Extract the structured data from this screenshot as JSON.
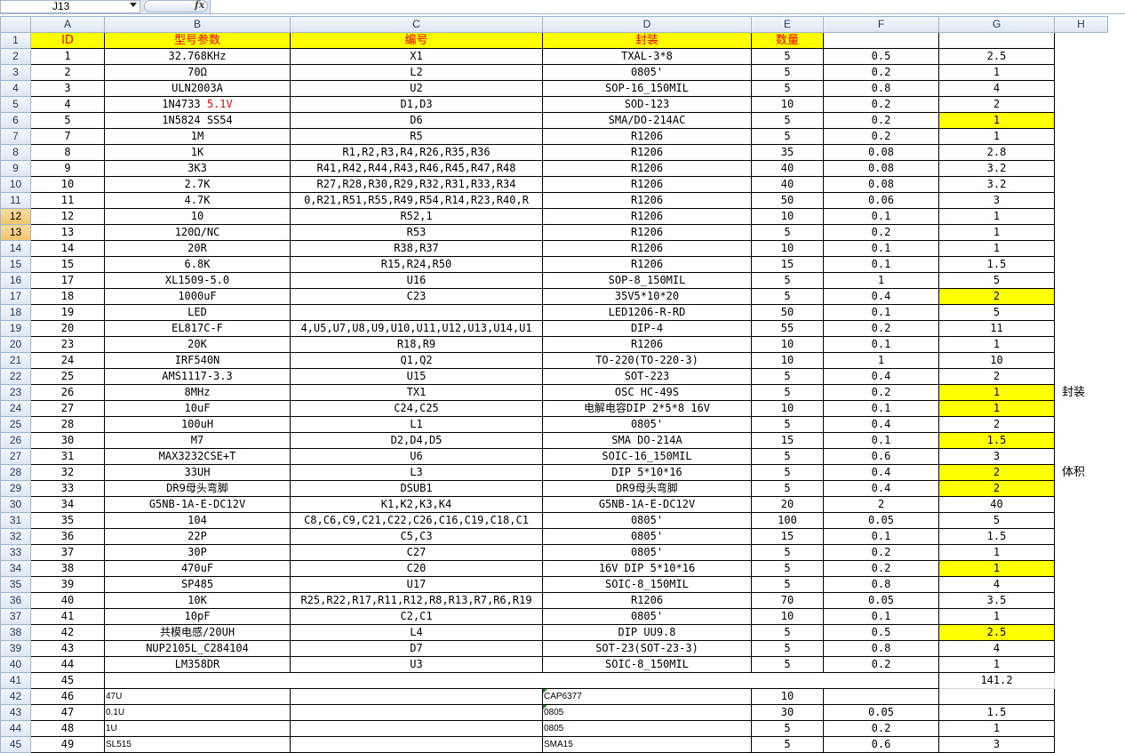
{
  "name_box": "J13",
  "fx_label": "fx",
  "columns": [
    "A",
    "B",
    "C",
    "D",
    "E",
    "F",
    "G",
    "H"
  ],
  "header": {
    "row": "1",
    "a": "ID",
    "b": "型号参数",
    "c": "编号",
    "d": "封装",
    "e": "数量"
  },
  "rows": [
    {
      "r": "2",
      "a": "1",
      "b": "32.768KHz",
      "c": "X1",
      "d": "TXAL-3*8",
      "e": "5",
      "f": "0.5",
      "g": "2.5",
      "h": ""
    },
    {
      "r": "3",
      "a": "2",
      "b": "70Ω",
      "c": "L2",
      "d": "0805'",
      "e": "5",
      "f": "0.2",
      "g": "1",
      "h": ""
    },
    {
      "r": "4",
      "a": "3",
      "b": "ULN2003A",
      "c": "U2",
      "d": "SOP-16_150MIL",
      "e": "5",
      "f": "0.8",
      "g": "4",
      "h": ""
    },
    {
      "r": "5",
      "a": "4",
      "b": "1N4733 ",
      "b2": "5.1V",
      "c": "D1,D3",
      "d": "SOD-123",
      "e": "10",
      "f": "0.2",
      "g": "2",
      "h": ""
    },
    {
      "r": "6",
      "a": "5",
      "b": "1N5824 SS54",
      "c": "D6",
      "d": "SMA/DO-214AC",
      "e": "5",
      "f": "0.2",
      "g": "1",
      "h": ""
    },
    {
      "r": "7",
      "a": "7",
      "b": "1M",
      "c": "R5",
      "d": "R1206",
      "e": "5",
      "f": "0.2",
      "g": "1",
      "h": ""
    },
    {
      "r": "8",
      "a": "8",
      "b": "1K",
      "c": "R1,R2,R3,R4,R26,R35,R36",
      "d": "R1206",
      "e": "35",
      "f": "0.08",
      "g": "2.8",
      "h": ""
    },
    {
      "r": "9",
      "a": "9",
      "b": "3K3",
      "c": "R41,R42,R44,R43,R46,R45,R47,R48",
      "d": "R1206",
      "e": "40",
      "f": "0.08",
      "g": "3.2",
      "h": ""
    },
    {
      "r": "10",
      "a": "10",
      "b": "2.7K",
      "c": "R27,R28,R30,R29,R32,R31,R33,R34",
      "d": "R1206",
      "e": "40",
      "f": "0.08",
      "g": "3.2",
      "h": ""
    },
    {
      "r": "11",
      "a": "11",
      "b": "4.7K",
      "c": "0,R21,R51,R55,R49,R54,R14,R23,R40,R",
      "d": "R1206",
      "e": "50",
      "f": "0.06",
      "g": "3",
      "h": ""
    },
    {
      "r": "12",
      "a": "12",
      "b": "10",
      "c": "R52,1",
      "d": "R1206",
      "e": "10",
      "f": "0.1",
      "g": "1",
      "h": ""
    },
    {
      "r": "13",
      "a": "13",
      "b": "120Ω/NC",
      "c": "R53",
      "d": "R1206",
      "e": "5",
      "f": "0.2",
      "g": "1",
      "h": ""
    },
    {
      "r": "14",
      "a": "14",
      "b": "20R",
      "c": "R38,R37",
      "d": "R1206",
      "e": "10",
      "f": "0.1",
      "g": "1",
      "h": ""
    },
    {
      "r": "15",
      "a": "15",
      "b": "6.8K",
      "c": "R15,R24,R50",
      "d": "R1206",
      "e": "15",
      "f": "0.1",
      "g": "1.5",
      "h": ""
    },
    {
      "r": "16",
      "a": "17",
      "b": "XL1509-5.0",
      "c": "U16",
      "d": "SOP-8_150MIL",
      "e": "5",
      "f": "1",
      "g": "5",
      "h": ""
    },
    {
      "r": "17",
      "a": "18",
      "b": "1000uF",
      "c": "C23",
      "d": "35V5*10*20",
      "e": "5",
      "f": "0.4",
      "g": "2",
      "h": ""
    },
    {
      "r": "18",
      "a": "19",
      "b": "LED",
      "c": "",
      "d": "LED1206-R-RD",
      "e": "50",
      "f": "0.1",
      "g": "5",
      "h": ""
    },
    {
      "r": "19",
      "a": "20",
      "b": "EL817C-F",
      "c": "4,U5,U7,U8,U9,U10,U11,U12,U13,U14,U1",
      "d": "DIP-4",
      "e": "55",
      "f": "0.2",
      "g": "11",
      "h": ""
    },
    {
      "r": "20",
      "a": "23",
      "b": "20K",
      "c": "R18,R9",
      "d": "R1206",
      "e": "10",
      "f": "0.1",
      "g": "1",
      "h": ""
    },
    {
      "r": "21",
      "a": "24",
      "b": "IRF540N",
      "c": "Q1,Q2",
      "d": "TO-220(TO-220-3)",
      "e": "10",
      "f": "1",
      "g": "10",
      "h": ""
    },
    {
      "r": "22",
      "a": "25",
      "b": "AMS1117-3.3",
      "c": "U15",
      "d": "SOT-223",
      "e": "5",
      "f": "0.4",
      "g": "2",
      "h": ""
    },
    {
      "r": "23",
      "a": "26",
      "b": "8MHz",
      "c": "TX1",
      "d": "OSC HC-49S",
      "e": "5",
      "f": "0.2",
      "g": "1",
      "h": "封装"
    },
    {
      "r": "24",
      "a": "27",
      "b": "10uF",
      "c": "C24,C25",
      "d": "电解电容DIP 2*5*8 16V",
      "e": "10",
      "f": "0.1",
      "g": "1",
      "h": ""
    },
    {
      "r": "25",
      "a": "28",
      "b": "100uH",
      "c": "L1",
      "d": "0805'",
      "e": "5",
      "f": "0.4",
      "g": "2",
      "h": ""
    },
    {
      "r": "26",
      "a": "30",
      "b": "M7",
      "c": "D2,D4,D5",
      "d": "SMA  DO-214A",
      "e": "15",
      "f": "0.1",
      "g": "1.5",
      "h": ""
    },
    {
      "r": "27",
      "a": "31",
      "b": "MAX3232CSE+T",
      "c": "U6",
      "d": "SOIC-16_150MIL",
      "e": "5",
      "f": "0.6",
      "g": "3",
      "h": ""
    },
    {
      "r": "28",
      "a": "32",
      "b": "33UH",
      "c": "L3",
      "d": "DIP 5*10*16",
      "e": "5",
      "f": "0.4",
      "g": "2",
      "h": "体积"
    },
    {
      "r": "29",
      "a": "33",
      "b": "DR9母头弯脚",
      "c": "DSUB1",
      "d": "DR9母头弯脚",
      "e": "5",
      "f": "0.4",
      "g": "2",
      "h": ""
    },
    {
      "r": "30",
      "a": "34",
      "b": "G5NB-1A-E-DC12V",
      "c": "K1,K2,K3,K4",
      "d": "G5NB-1A-E-DC12V",
      "e": "20",
      "f": "2",
      "g": "40",
      "h": ""
    },
    {
      "r": "31",
      "a": "35",
      "b": "104",
      "c": "C8,C6,C9,C21,C22,C26,C16,C19,C18,C1",
      "d": "0805'",
      "e": "100",
      "f": "0.05",
      "g": "5",
      "h": ""
    },
    {
      "r": "32",
      "a": "36",
      "b": "22P",
      "c": "C5,C3",
      "d": "0805'",
      "e": "15",
      "f": "0.1",
      "g": "1.5",
      "h": ""
    },
    {
      "r": "33",
      "a": "37",
      "b": "30P",
      "c": "C27",
      "d": "0805'",
      "e": "5",
      "f": "0.2",
      "g": "1",
      "h": ""
    },
    {
      "r": "34",
      "a": "38",
      "b": "470uF",
      "c": "C20",
      "d": "16V DIP 5*10*16",
      "e": "5",
      "f": "0.2",
      "g": "1",
      "h": ""
    },
    {
      "r": "35",
      "a": "39",
      "b": "SP485",
      "c": "U17",
      "d": "SOIC-8_150MIL",
      "e": "5",
      "f": "0.8",
      "g": "4",
      "h": ""
    },
    {
      "r": "36",
      "a": "40",
      "b": "10K",
      "c": "R25,R22,R17,R11,R12,R8,R13,R7,R6,R19",
      "d": "R1206",
      "e": "70",
      "f": "0.05",
      "g": "3.5",
      "h": ""
    },
    {
      "r": "37",
      "a": "41",
      "b": "10pF",
      "c": "C2,C1",
      "d": "0805'",
      "e": "10",
      "f": "0.1",
      "g": "1",
      "h": ""
    },
    {
      "r": "38",
      "a": "42",
      "b": "共模电感/20UH",
      "c": "L4",
      "d": "DIP UU9.8",
      "e": "5",
      "f": "0.5",
      "g": "2.5",
      "h": ""
    },
    {
      "r": "39",
      "a": "43",
      "b": "NUP2105L_C284104",
      "c": "D7",
      "d": "SOT-23(SOT-23-3)",
      "e": "5",
      "f": "0.8",
      "g": "4",
      "h": ""
    },
    {
      "r": "40",
      "a": "44",
      "b": "LM358DR",
      "c": "U3",
      "d": "SOIC-8_150MIL",
      "e": "5",
      "f": "0.2",
      "g": "1",
      "h": ""
    }
  ],
  "yellow_rows": [
    "6",
    "17",
    "23",
    "24",
    "26",
    "28",
    "29",
    "34",
    "38"
  ],
  "total_row": {
    "r": "41",
    "a": "45",
    "g": "141.2"
  },
  "extra_rows": [
    {
      "r": "42",
      "a": "46",
      "b": "47U",
      "c": "",
      "d": "CAP6377",
      "e": "10",
      "f": "",
      "g": ""
    },
    {
      "r": "43",
      "a": "47",
      "b": "0.1U",
      "c": "",
      "d": "0805",
      "e": "30",
      "f": "0.05",
      "g": "1.5"
    },
    {
      "r": "44",
      "a": "48",
      "b": "1U",
      "c": "",
      "d": "0805",
      "e": "5",
      "f": "0.2",
      "g": "1"
    },
    {
      "r": "45",
      "a": "49",
      "b": "SL515",
      "c": "",
      "d": "SMA15",
      "e": "5",
      "f": "0.6",
      "g": "3"
    }
  ],
  "colors": {
    "yellow": "#ffff00",
    "header_red": "#ff0000",
    "selected_header": "#f4c46a"
  }
}
